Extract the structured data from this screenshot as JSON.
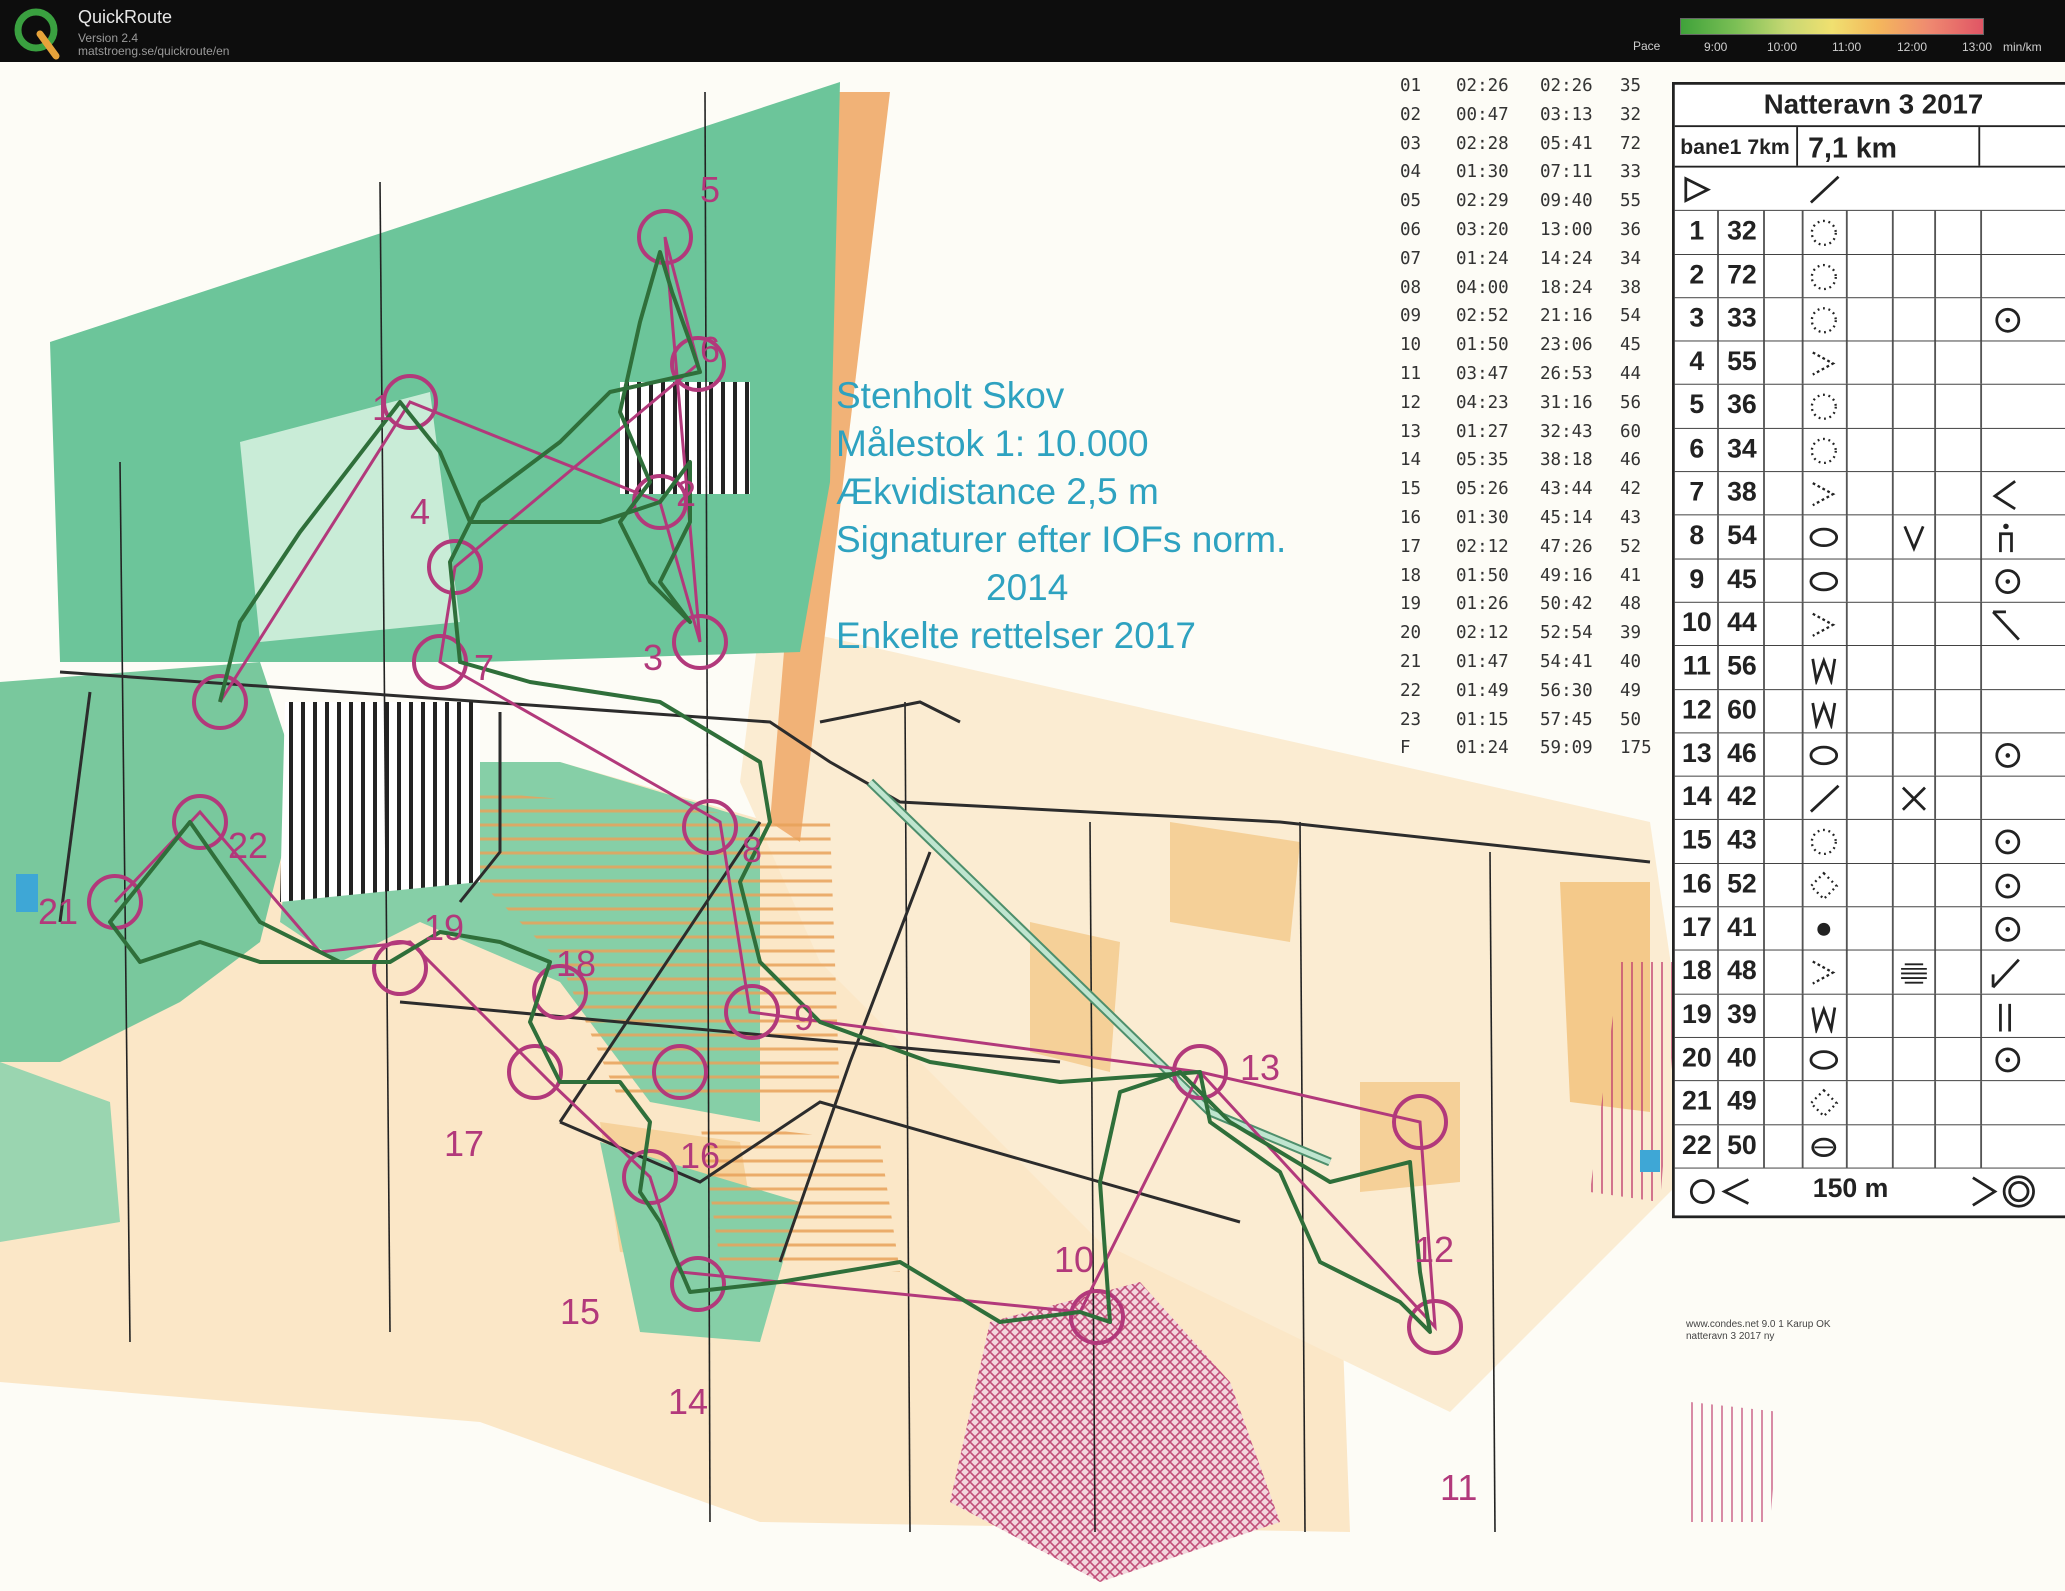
{
  "app": {
    "name": "QuickRoute",
    "version": "Version 2.4",
    "url": "matstroeng.se/quickroute/en"
  },
  "pace_legend": {
    "label": "Pace",
    "ticks": [
      "9:00",
      "10:00",
      "11:00",
      "12:00",
      "13:00"
    ],
    "unit": "min/km"
  },
  "map_info": [
    "Stenholt Skov",
    "Målestok   1: 10.000",
    "Ækvidistance 2,5 m",
    "Signaturer efter IOFs norm.",
    "2014",
    "Enkelte rettelser 2017"
  ],
  "splits": [
    [
      "01",
      "02:26",
      "02:26",
      "35"
    ],
    [
      "02",
      "00:47",
      "03:13",
      "32"
    ],
    [
      "03",
      "02:28",
      "05:41",
      "72"
    ],
    [
      "04",
      "01:30",
      "07:11",
      "33"
    ],
    [
      "05",
      "02:29",
      "09:40",
      "55"
    ],
    [
      "06",
      "03:20",
      "13:00",
      "36"
    ],
    [
      "07",
      "01:24",
      "14:24",
      "34"
    ],
    [
      "08",
      "04:00",
      "18:24",
      "38"
    ],
    [
      "09",
      "02:52",
      "21:16",
      "54"
    ],
    [
      "10",
      "01:50",
      "23:06",
      "45"
    ],
    [
      "11",
      "03:47",
      "26:53",
      "44"
    ],
    [
      "12",
      "04:23",
      "31:16",
      "56"
    ],
    [
      "13",
      "01:27",
      "32:43",
      "60"
    ],
    [
      "14",
      "05:35",
      "38:18",
      "46"
    ],
    [
      "15",
      "05:26",
      "43:44",
      "42"
    ],
    [
      "16",
      "01:30",
      "45:14",
      "43"
    ],
    [
      "17",
      "02:12",
      "47:26",
      "52"
    ],
    [
      "18",
      "01:50",
      "49:16",
      "41"
    ],
    [
      "19",
      "01:26",
      "50:42",
      "48"
    ],
    [
      "20",
      "02:12",
      "52:54",
      "39"
    ],
    [
      "21",
      "01:47",
      "54:41",
      "40"
    ],
    [
      "22",
      "01:49",
      "56:30",
      "49"
    ],
    [
      "23",
      "01:15",
      "57:45",
      "50"
    ],
    [
      "F",
      "01:24",
      "59:09",
      "175"
    ]
  ],
  "description": {
    "title": "Natteravn 3 2017",
    "course": "bane1 7km",
    "length": "7,1 km",
    "controls": [
      [
        "1",
        "32"
      ],
      [
        "2",
        "72"
      ],
      [
        "3",
        "33"
      ],
      [
        "4",
        "55"
      ],
      [
        "5",
        "36"
      ],
      [
        "6",
        "34"
      ],
      [
        "7",
        "38"
      ],
      [
        "8",
        "54"
      ],
      [
        "9",
        "45"
      ],
      [
        "10",
        "44"
      ],
      [
        "11",
        "56"
      ],
      [
        "12",
        "60"
      ],
      [
        "13",
        "46"
      ],
      [
        "14",
        "42"
      ],
      [
        "15",
        "43"
      ],
      [
        "16",
        "52"
      ],
      [
        "17",
        "41"
      ],
      [
        "18",
        "48"
      ],
      [
        "19",
        "39"
      ],
      [
        "20",
        "40"
      ],
      [
        "21",
        "49"
      ],
      [
        "22",
        "50"
      ]
    ],
    "finish_distance": "150 m",
    "credit1": "www.condes.net 9.0 1 Karup OK",
    "credit2": "natteravn 3 2017 ny"
  },
  "control_labels": [
    "1",
    "2",
    "3",
    "4",
    "5",
    "6",
    "7",
    "8",
    "9",
    "10",
    "11",
    "12",
    "13",
    "14",
    "15",
    "16",
    "17",
    "18",
    "19",
    "21",
    "22"
  ],
  "colors": {
    "course": "#b2397b",
    "route": "#2f6f3a",
    "forest": "#5fbf8f",
    "open": "#f4c98a",
    "info_text": "#2ea2c0"
  }
}
